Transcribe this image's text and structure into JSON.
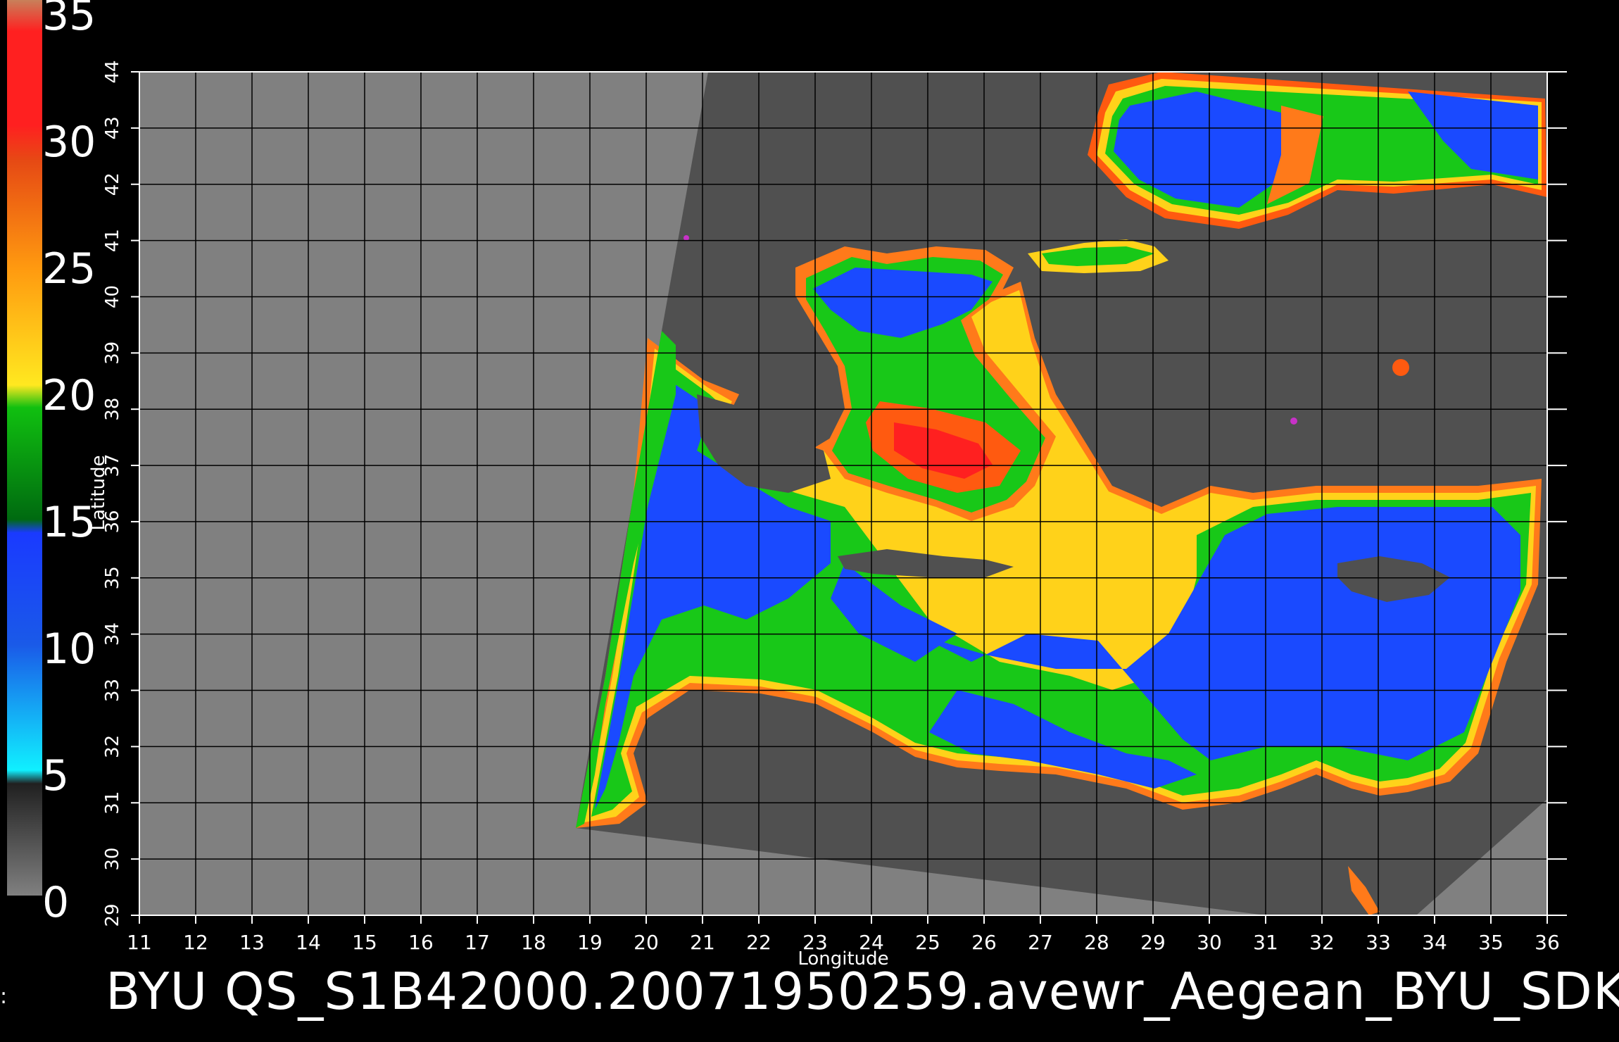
{
  "caption": "BYU  QS_S1B42000.20071950259.avewr_Aegean_BYU_SDK",
  "side_mark": ":",
  "colorbar": {
    "ticks": [
      "35",
      "30",
      "25",
      "20",
      "15",
      "10",
      "5",
      "0"
    ],
    "colors": [
      "#c86a4a",
      "#ff1a1a",
      "#ff7a1a",
      "#ffd21a",
      "#18c818",
      "#1a4aff",
      "#1ae0ff",
      "#505050"
    ]
  },
  "axes": {
    "xlabel": "Longitude",
    "ylabel": "Latitude",
    "x_ticks": [
      "11",
      "12",
      "13",
      "14",
      "15",
      "16",
      "17",
      "18",
      "19",
      "20",
      "21",
      "22",
      "23",
      "24",
      "25",
      "26",
      "27",
      "28",
      "29",
      "30",
      "31",
      "32",
      "33",
      "34",
      "35",
      "36"
    ],
    "y_ticks": [
      "29",
      "30",
      "31",
      "32",
      "33",
      "34",
      "35",
      "36",
      "37",
      "38",
      "39",
      "40",
      "41",
      "42",
      "43",
      "44"
    ]
  },
  "colors": {
    "background": "#000000",
    "outside_swath": "#808080",
    "land_in_swath": "#505050",
    "grid": "#000000"
  }
}
